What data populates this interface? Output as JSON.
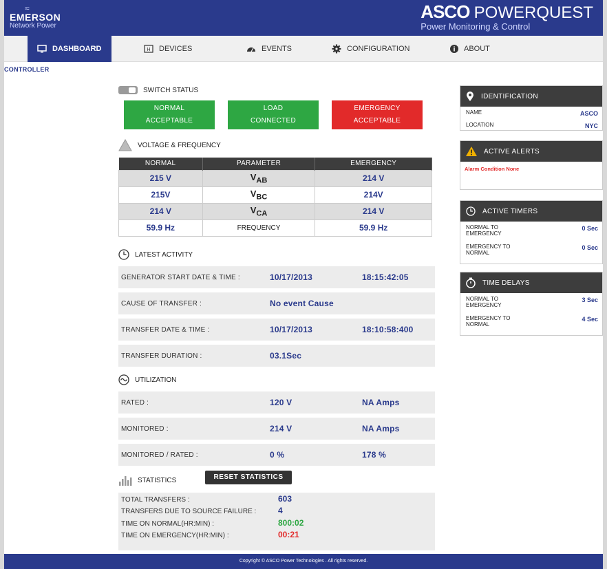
{
  "header": {
    "brand_mark": "≈",
    "company": "EMERSON",
    "company_sub": "Network Power",
    "product_bold": "ASCO",
    "product_light": "POWERQUEST",
    "product_sub": "Power Monitoring & Control"
  },
  "nav": {
    "dashboard": "DASHBOARD",
    "devices": "DEVICES",
    "events": "EVENTS",
    "configuration": "CONFIGURATION",
    "about": "ABOUT"
  },
  "breadcrumb": "CONTROLLER",
  "switch_status": {
    "title": "SWITCH STATUS",
    "toggle_text": "0 1",
    "normal_l1": "NORMAL",
    "normal_l2": "ACCEPTABLE",
    "load_l1": "LOAD",
    "load_l2": "CONNECTED",
    "emerg_l1": "EMERGENCY",
    "emerg_l2": "ACCEPTABLE",
    "colors": {
      "ok": "#2ea743",
      "alert": "#e22a2a"
    }
  },
  "voltage": {
    "title": "VOLTAGE & FREQUENCY",
    "headers": [
      "NORMAL",
      "PARAMETER",
      "EMERGENCY"
    ],
    "rows": [
      {
        "normal": "215 V",
        "param": "V",
        "sub": "AB",
        "emergency": "214 V"
      },
      {
        "normal": "215V",
        "param": "V",
        "sub": "BC",
        "emergency": "214V"
      },
      {
        "normal": "214 V",
        "param": "V",
        "sub": "CA",
        "emergency": "214 V"
      },
      {
        "normal": "59.9 Hz",
        "param": "FREQUENCY",
        "sub": "",
        "emergency": "59.9 Hz"
      }
    ]
  },
  "activity": {
    "title": "LATEST ACTIVITY",
    "gen_label": "GENERATOR START DATE & TIME :",
    "gen_date": "10/17/2013",
    "gen_time": "18:15:42:05",
    "cause_label": "CAUSE OF TRANSFER :",
    "cause_value": "No event Cause",
    "transfer_label": "TRANSFER DATE & TIME :",
    "transfer_date": "10/17/2013",
    "transfer_time": "18:10:58:400",
    "duration_label": "TRANSFER DURATION :",
    "duration_value": "03.1Sec"
  },
  "utilization": {
    "title": "UTILIZATION",
    "rated_label": "RATED :",
    "rated_v": "120 V",
    "rated_a": "NA Amps",
    "mon_label": "MONITORED :",
    "mon_v": "214 V",
    "mon_a": "NA Amps",
    "ratio_label": "MONITORED / RATED :",
    "ratio_v": "0 %",
    "ratio_a": "178 %"
  },
  "statistics": {
    "title": "STATISTICS",
    "reset": "RESET STATISTICS",
    "total_label": "TOTAL TRANSFERS :",
    "total": "603",
    "failure_label": "TRANSFERS DUE TO SOURCE FAILURE :",
    "failure": "4",
    "normal_label": "TIME ON NORMAL(HR:MIN) :",
    "normal": "800:02",
    "emerg_label": "TIME ON EMERGENCY(HR:MIN) :",
    "emerg": "00:21"
  },
  "identification": {
    "title": "IDENTIFICATION",
    "name_label": "NAME",
    "name": "ASCO",
    "location_label": "LOCATION",
    "location": "NYC"
  },
  "alerts": {
    "title": "ACTIVE ALERTS",
    "text": "Alarm Condition None"
  },
  "timers": {
    "title": "ACTIVE TIMERS",
    "n2e_label": "NORMAL TO EMERGENCY",
    "n2e": "0 Sec",
    "e2n_label": "EMERGENCY TO NORMAL",
    "e2n": "0 Sec"
  },
  "delays": {
    "title": "TIME DELAYS",
    "n2e_label": "NORMAL TO EMERGENCY",
    "n2e": "3 Sec",
    "e2n_label": "EMERGENCY TO NORMAL",
    "e2n": "4 Sec"
  },
  "footer": "Copyright © ASCO Power Technologies . All rights reserved."
}
